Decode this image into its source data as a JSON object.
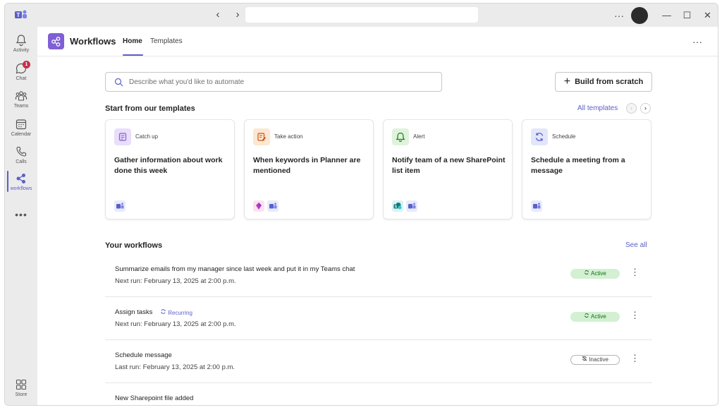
{
  "window": {
    "search_placeholder": ""
  },
  "rail": {
    "items": [
      {
        "label": "Activity",
        "icon": "bell-icon"
      },
      {
        "label": "Chat",
        "icon": "chat-icon",
        "badge": "1"
      },
      {
        "label": "Teams",
        "icon": "teams-icon"
      },
      {
        "label": "Calendar",
        "icon": "calendar-icon"
      },
      {
        "label": "Calls",
        "icon": "phone-icon"
      },
      {
        "label": "workflows",
        "icon": "workflows-icon"
      }
    ],
    "more": "•••",
    "store": {
      "label": "Store",
      "icon": "store-icon"
    }
  },
  "header": {
    "title": "Workflows",
    "tabs": [
      {
        "label": "Home"
      },
      {
        "label": "Templates"
      }
    ],
    "more": "···"
  },
  "describe": {
    "placeholder": "Describe what you'd like to automate"
  },
  "build_button": {
    "icon": "plus-icon",
    "label": "Build from scratch"
  },
  "templates_section": {
    "title": "Start from our templates",
    "all_link": "All templates",
    "prev": "‹",
    "next": "›",
    "cards": [
      {
        "category": "Catch up",
        "title": "Gather information about work done this week",
        "icon": "catch-up-icon",
        "icon_color": "#e9defb",
        "apps": [
          "teams-app-icon"
        ]
      },
      {
        "category": "Take action",
        "title": "When keywords in Planner are mentioned",
        "icon": "take-action-icon",
        "icon_color": "#fde6d2",
        "apps": [
          "planner-app-icon",
          "teams-app-icon"
        ]
      },
      {
        "category": "Alert",
        "title": "Notify team of a new SharePoint list item",
        "icon": "alert-icon",
        "icon_color": "#dff3dc",
        "apps": [
          "sharepoint-app-icon",
          "teams-app-icon"
        ]
      },
      {
        "category": "Schedule",
        "title": "Schedule a meeting from a message",
        "icon": "schedule-icon",
        "icon_color": "#e2e6fb",
        "apps": [
          "teams-app-icon"
        ]
      }
    ]
  },
  "workflows_section": {
    "title": "Your workflows",
    "see_all": "See all",
    "rows": [
      {
        "name": "Summarize emails from my manager since last week and put it in my Teams chat",
        "recurring": "",
        "run": "Next run: February 13, 2025 at 2:00 p.m.",
        "status": "Active"
      },
      {
        "name": "Assign tasks",
        "recurring": "Recurring",
        "run": "Next run: February 13, 2025 at 2:00 p.m.",
        "status": "Active"
      },
      {
        "name": "Schedule message",
        "recurring": "",
        "run": "Last run: February 13, 2025 at 2:00 p.m.",
        "status": "Inactive"
      },
      {
        "name": "New Sharepoint file added",
        "recurring": "",
        "run": "",
        "status": ""
      }
    ]
  },
  "colors": {
    "accent": "#5b5fc7",
    "active_bg": "#d3f0d3",
    "active_text": "#0e700e",
    "badge": "#c4314b"
  }
}
